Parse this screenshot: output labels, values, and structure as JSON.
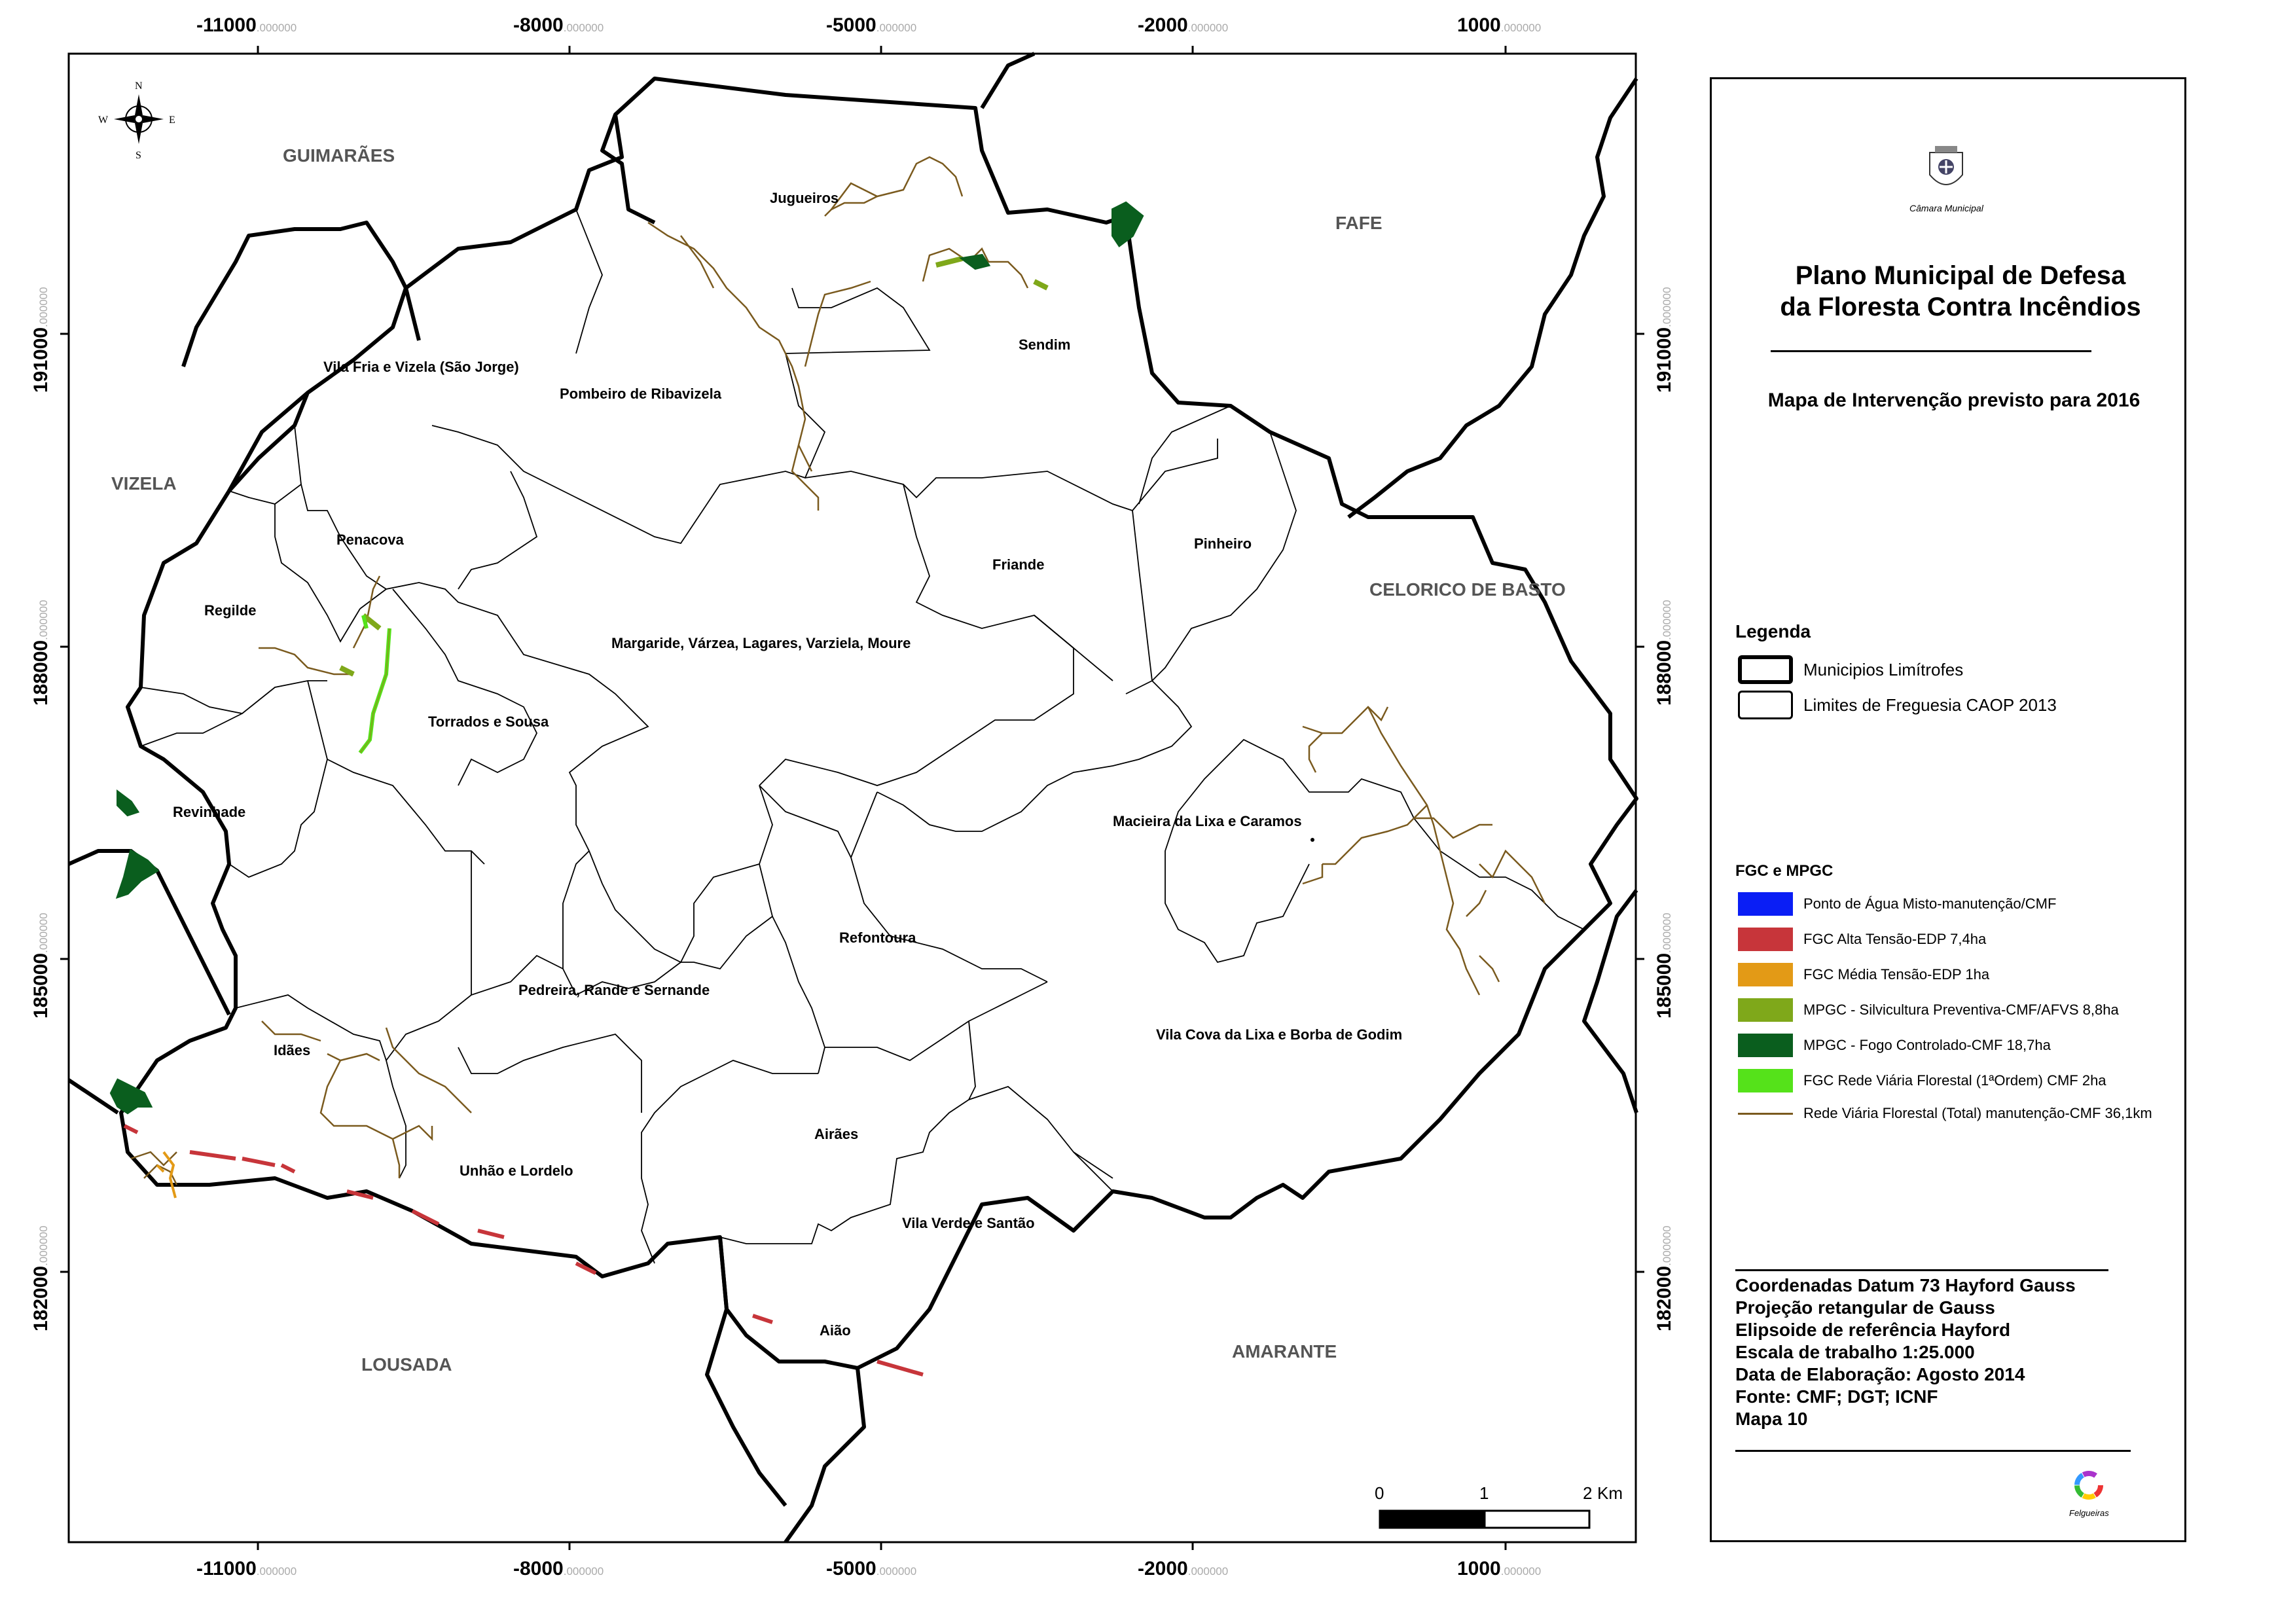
{
  "title": "Plano Municipal de Defesa da Floresta Contra Incêndios",
  "title_line1": "Plano Municipal de Defesa",
  "title_line2": "da Floresta Contra Incêndios",
  "subtitle": "Mapa de Intervenção previsto para 2016",
  "logo_label": "Câmara Municipal",
  "felgueiras_logo_label": "Felgueiras",
  "north_arrow": {
    "n": "N",
    "s": "S",
    "e": "E",
    "w": "W"
  },
  "grid": {
    "x_ticks": [
      "-11000",
      "-8000",
      "-5000",
      "-2000",
      "1000"
    ],
    "x_decimals": ".000000",
    "y_ticks": [
      "191000",
      "188000",
      "185000",
      "182000"
    ],
    "y_decimals": ".000000"
  },
  "municipalities": [
    "GUIMARÃES",
    "FAFE",
    "VIZELA",
    "CELORICO DE BASTO",
    "LOUSADA",
    "AMARANTE"
  ],
  "parishes": [
    "Jugueiros",
    "Sendim",
    "Vila Fria e Vizela (São Jorge)",
    "Pombeiro de Ribavizela",
    "Penacova",
    "Friande",
    "Pinheiro",
    "Regilde",
    "Margaride, Várzea, Lagares, Varziela, Moure",
    "Torrados e Sousa",
    "Revinhade",
    "Macieira da Lixa e Caramos",
    "Refontoura",
    "Pedreira, Rande e Sernande",
    "Idães",
    "Vila Cova da Lixa e Borba de Godim",
    "Airães",
    "Unhão e Lordelo",
    "Vila Verde e Santão",
    "Aião"
  ],
  "legend": {
    "title": "Legenda",
    "items": [
      {
        "label": "Municipios Limítrofes",
        "style": "thick"
      },
      {
        "label": "Limites de Freguesia CAOP 2013",
        "style": "thin"
      }
    ]
  },
  "fgc": {
    "title": "FGC e MPGC",
    "items": [
      {
        "label": "Ponto de Água Misto-manutenção/CMF",
        "color": "#0a1ef5"
      },
      {
        "label": "FGC Alta Tensão-EDP 7,4ha",
        "color": "#c7353a"
      },
      {
        "label": "FGC Média Tensão-EDP 1ha",
        "color": "#e39a16"
      },
      {
        "label": "MPGC - Silvicultura Preventiva-CMF/AFVS 8,8ha",
        "color": "#7fa81a"
      },
      {
        "label": "MPGC - Fogo Controlado-CMF 18,7ha",
        "color": "#0a5e1e"
      },
      {
        "label": "FGC Rede Viária Florestal (1ªOrdem) CMF 2ha",
        "color": "#55e21a"
      },
      {
        "label": "Rede Viária Florestal (Total) manutenção-CMF 36,1km",
        "color": "#7a5a1e",
        "line": true
      }
    ]
  },
  "meta": [
    "Coordenadas Datum 73 Hayford Gauss",
    "Projeção retangular de Gauss",
    "Elipsoide de referência Hayford",
    "Escala de trabalho 1:25.000",
    "Data de Elaboração: Agosto 2014",
    "Fonte: CMF; DGT; ICNF",
    "Mapa 10"
  ],
  "scale_bar": {
    "labels": [
      "0",
      "1",
      "2"
    ],
    "unit": "Km"
  }
}
